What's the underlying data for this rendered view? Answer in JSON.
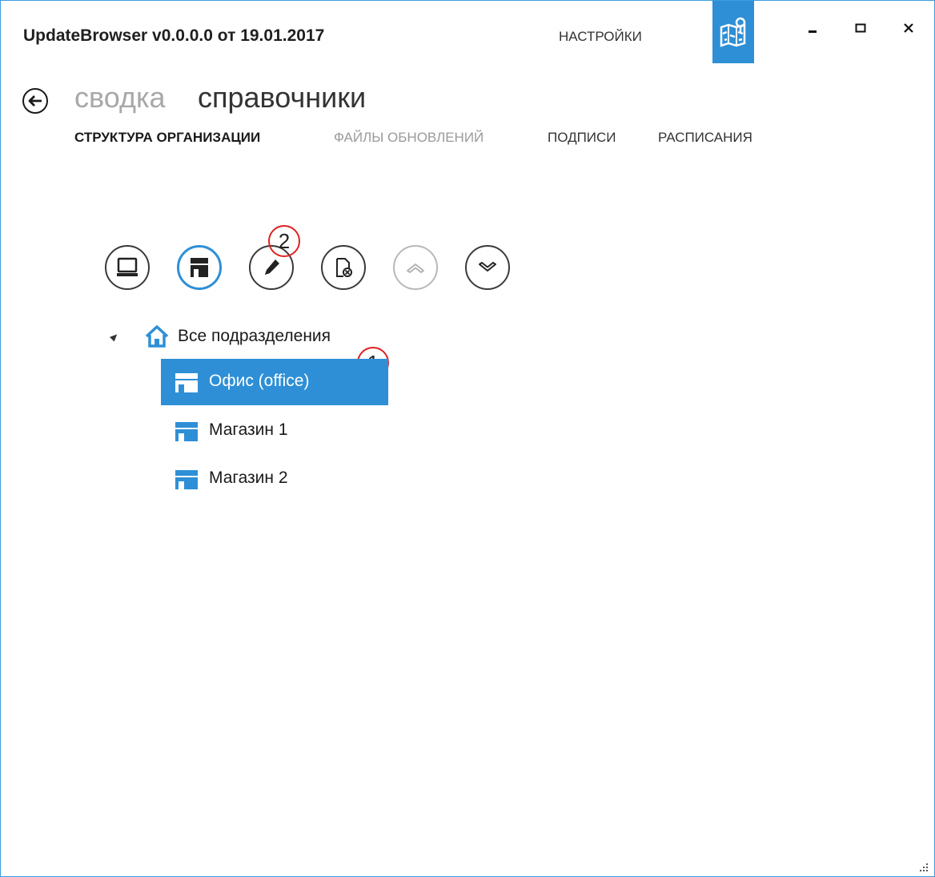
{
  "window": {
    "title": "UpdateBrowser v0.0.0.0 от 19.01.2017",
    "settings_label": "НАСТРОЙКИ",
    "accent_color": "#2e8fd6"
  },
  "navigation": {
    "previous": "сводка",
    "current": "справочники"
  },
  "subtabs": [
    {
      "label": "СТРУКТУРА ОРГАНИЗАЦИИ",
      "state": "active"
    },
    {
      "label": "ФАЙЛЫ ОБНОВЛЕНИЙ",
      "state": "dim"
    },
    {
      "label": "ПОДПИСИ",
      "state": "normal"
    },
    {
      "label": "РАСПИСАНИЯ",
      "state": "normal"
    }
  ],
  "toolbar": {
    "icons": [
      "computer-icon",
      "store-icon",
      "pencil-icon",
      "document-remove-icon",
      "chevron-up-icon",
      "chevron-down-icon"
    ]
  },
  "annotations": [
    "1",
    "2"
  ],
  "tree": {
    "root": {
      "label": "Все подразделения",
      "icon": "home-icon",
      "expanded": true
    },
    "items": [
      {
        "label": "Офис (office)",
        "icon": "store-icon",
        "selected": true
      },
      {
        "label": "Магазин 1",
        "icon": "store-icon",
        "selected": false
      },
      {
        "label": "Магазин 2",
        "icon": "store-icon",
        "selected": false
      }
    ]
  }
}
